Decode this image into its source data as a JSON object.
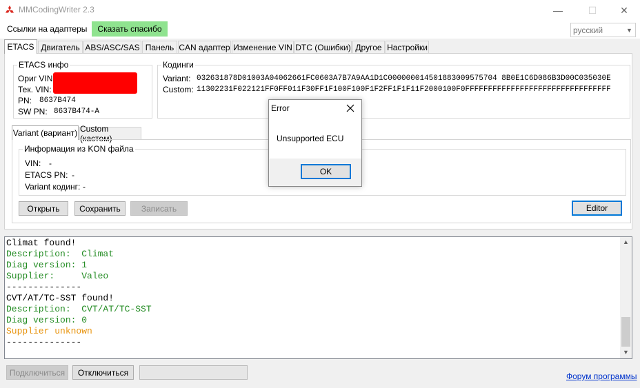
{
  "window": {
    "title": "MMCodingWriter 2.3",
    "minimize_glyph": "—",
    "maximize_glyph": "☐",
    "close_glyph": "✕"
  },
  "menu": {
    "adapters_link": "Ссылки на адаптеры",
    "thanks_button": "Сказать спасибо",
    "language_value": "русский"
  },
  "tabs": [
    "ETACS",
    "Двигатель",
    "ABS/ASC/SAS",
    "Панель",
    "CAN адаптер",
    "Изменение VIN",
    "DTC (Ошибки)",
    "Другое",
    "Настройки"
  ],
  "etacs_info": {
    "legend": "ETACS инфо",
    "orig_vin_label": "Ориг VIN:",
    "cur_vin_label": "Тек. VIN:",
    "pn_label": "PN:",
    "pn_value": "8637B474",
    "swpn_label": "SW PN:",
    "swpn_value": "8637B474-A"
  },
  "codings": {
    "legend": "Кодинги",
    "variant_label": "Variant:",
    "variant_value": "032631878D01003A04062661FC0603A7B7A9AA1D1C000000014501883009575704 8B0E1C6D086B3D00C035030E",
    "custom_label": "Custom:",
    "custom_value": "11302231F022121FF0FF011F30FF1F100F100F1F2FF1F1F11F2000100F0FFFFFFFFFFFFFFFFFFFFFFFFFFFFFFFF"
  },
  "subtabs": [
    "Variant (вариант)",
    "Custom (кастом)"
  ],
  "kon_info": {
    "legend": "Информация из KON файла",
    "vin_label": "VIN:",
    "vin_value": "-",
    "etacs_pn_label": "ETACS PN:",
    "etacs_pn_value": "-",
    "variant_label": "Variant кодинг:",
    "variant_value": "-"
  },
  "buttons": {
    "open": "Открыть",
    "save": "Сохранить",
    "write": "Записать",
    "editor": "Editor",
    "connect": "Подключиться",
    "disconnect": "Отключиться"
  },
  "log": [
    {
      "text": "Climat found!",
      "color": "#000000"
    },
    {
      "text": "Description:  Climat",
      "color": "#228b22"
    },
    {
      "text": "Diag version: 1",
      "color": "#228b22"
    },
    {
      "text": "Supplier:     Valeo",
      "color": "#228b22"
    },
    {
      "text": "--------------",
      "color": "#000000"
    },
    {
      "text": "CVT/AT/TC-SST found!",
      "color": "#000000"
    },
    {
      "text": "Description:  CVT/AT/TC-SST",
      "color": "#228b22"
    },
    {
      "text": "Diag version: 0",
      "color": "#228b22"
    },
    {
      "text": "Supplier unknown",
      "color": "#e8940f"
    },
    {
      "text": "--------------",
      "color": "#000000"
    }
  ],
  "forum_link": "Форум программы",
  "dialog": {
    "title": "Error",
    "message": "Unsupported ECU",
    "ok": "OK"
  },
  "colors": {
    "redaction": "#ff0000",
    "thanks_bg": "#8fe38f",
    "accent": "#0078d7"
  }
}
